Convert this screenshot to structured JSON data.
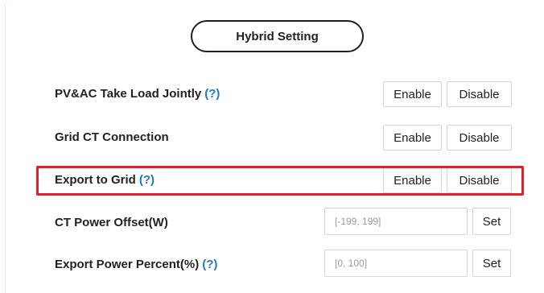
{
  "section": {
    "title": "Hybrid Setting"
  },
  "rows": [
    {
      "label": "PV&AC Take Load Jointly",
      "help": "(?)",
      "enable": "Enable",
      "disable": "Disable"
    },
    {
      "label": "Grid CT Connection",
      "enable": "Enable",
      "disable": "Disable"
    },
    {
      "label": "Export to Grid",
      "help": "(?)",
      "enable": "Enable",
      "disable": "Disable"
    },
    {
      "label": "CT Power Offset(W)",
      "placeholder": "[-199, 199]",
      "set": "Set"
    },
    {
      "label": "Export Power Percent(%)",
      "help": "(?)",
      "placeholder": "[0, 100]",
      "set": "Set"
    }
  ],
  "colors": {
    "highlight": "#e0212b",
    "help_link": "#1f78c8"
  }
}
